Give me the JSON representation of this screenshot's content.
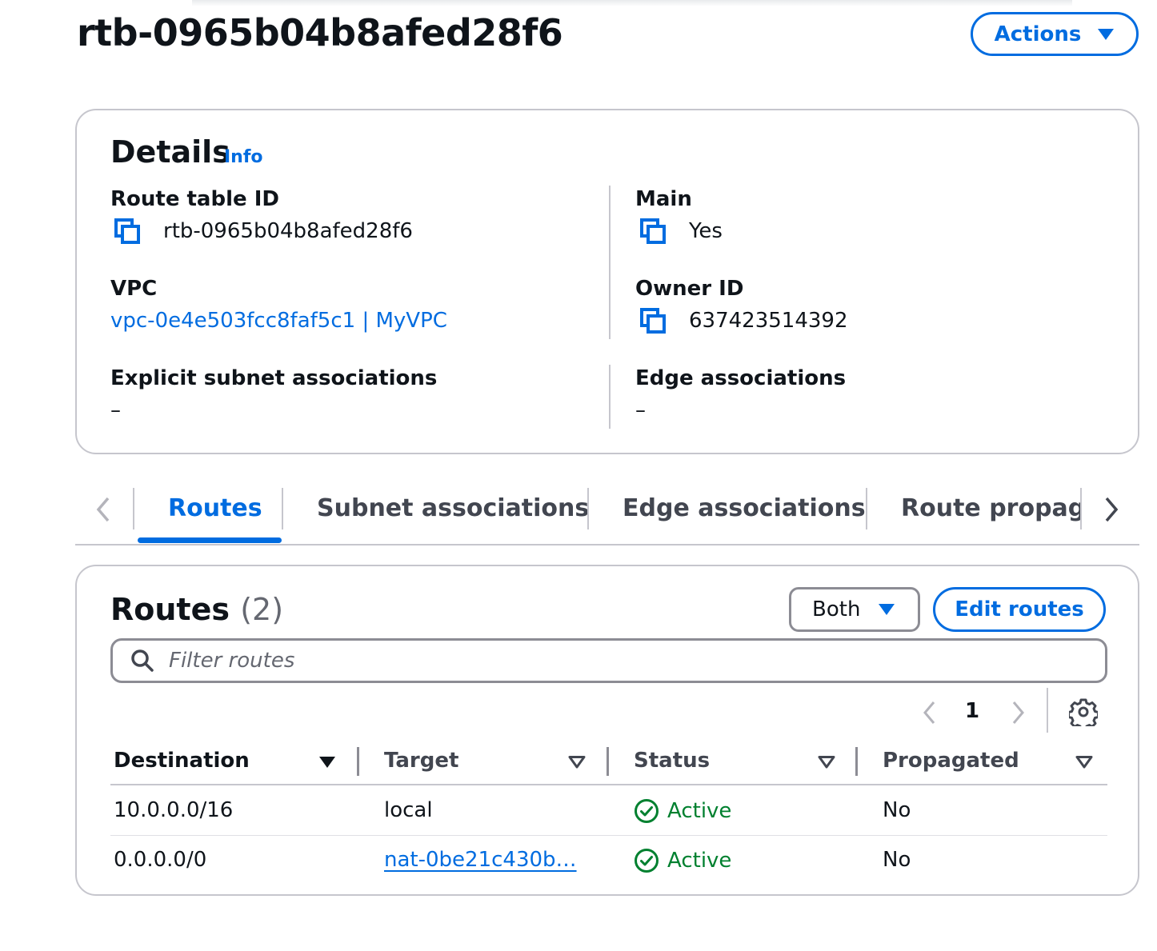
{
  "header": {
    "title": "rtb-0965b04b8afed28f6",
    "actions_label": "Actions"
  },
  "details": {
    "heading": "Details",
    "info_label": "Info",
    "route_table_id_label": "Route table ID",
    "route_table_id_value": "rtb-0965b04b8afed28f6",
    "main_label": "Main",
    "main_value": "Yes",
    "vpc_label": "VPC",
    "vpc_value": "vpc-0e4e503fcc8faf5c1 | MyVPC",
    "owner_id_label": "Owner ID",
    "owner_id_value": "637423514392",
    "explicit_subnet_label": "Explicit subnet associations",
    "explicit_subnet_value": "–",
    "edge_assoc_label": "Edge associations",
    "edge_assoc_value": "–"
  },
  "tabs": [
    {
      "label": "Routes",
      "active": true
    },
    {
      "label": "Subnet associations",
      "active": false
    },
    {
      "label": "Edge associations",
      "active": false
    },
    {
      "label": "Route propagation",
      "active": false
    }
  ],
  "routes": {
    "title": "Routes",
    "count": "(2)",
    "filter_value": "Both",
    "edit_label": "Edit routes",
    "search_placeholder": "Filter routes",
    "page": "1",
    "columns": [
      "Destination",
      "Target",
      "Status",
      "Propagated"
    ],
    "rows": [
      {
        "destination": "10.0.0.0/16",
        "target": "local",
        "target_is_link": false,
        "status": "Active",
        "propagated": "No"
      },
      {
        "destination": "0.0.0.0/0",
        "target": "nat-0be21c430b…",
        "target_is_link": true,
        "status": "Active",
        "propagated": "No"
      }
    ]
  },
  "colors": {
    "accent": "#006ce0",
    "success": "#00802f",
    "border": "#c6c6cd",
    "text": "#0f141a"
  },
  "icons": [
    "copy-icon",
    "caret-down-icon",
    "chevron-left-icon",
    "chevron-right-icon",
    "search-icon",
    "gear-icon",
    "status-success-icon",
    "sort-icon"
  ]
}
